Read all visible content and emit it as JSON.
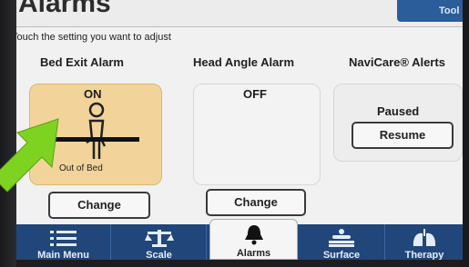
{
  "header": {
    "title": "Alarms",
    "tab_label": "Tool"
  },
  "instruction": "Touch the setting you want to adjust",
  "panels": [
    {
      "title": "Bed Exit Alarm",
      "status": "ON",
      "caption": "Out of Bed",
      "button": "Change",
      "icon": "bed-exit-figure-icon"
    },
    {
      "title": "Head Angle Alarm",
      "status": "OFF",
      "button": "Change"
    },
    {
      "title": "NaviCare® Alerts",
      "status": "Paused",
      "button": "Resume"
    }
  ],
  "nav": [
    {
      "label": "Main Menu",
      "icon": "list-icon"
    },
    {
      "label": "Scale",
      "icon": "scale-icon"
    },
    {
      "label": "Alarms",
      "icon": "bell-icon",
      "active": true
    },
    {
      "label": "Surface",
      "icon": "surface-icon"
    },
    {
      "label": "Therapy",
      "icon": "lungs-icon"
    }
  ],
  "colors": {
    "accent_nav": "#21467a",
    "active_card": "#f2d49a",
    "overlay_arrow": "#7ed321"
  }
}
